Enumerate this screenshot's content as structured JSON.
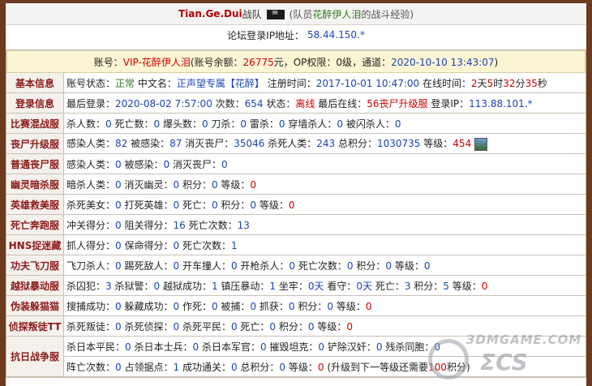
{
  "header": {
    "team": "Tian.Ge.Dui",
    "team_suffix": "战队",
    "member_prefix": "(队员",
    "member_name": "花醉伊人泪",
    "member_suffix": "的战斗经验)",
    "ip_label": "论坛登录IP地址：",
    "ip_value": "58.44.150.*",
    "flag_icon": "pirate-flag-icon"
  },
  "account": {
    "prefix": "账号：",
    "name": "VIP-花醉伊人泪",
    "balance_label": "(账号余额：",
    "balance": "26775",
    "balance_unit": "元，OP权限：",
    "op_level": "0级",
    "channel_label": "，通道：",
    "datetime": "2020-10-10 13:43:07",
    "close": ")"
  },
  "rows": [
    {
      "cat": "基本信息",
      "parts": [
        {
          "t": "账号状态：",
          "c": ""
        },
        {
          "t": "正常",
          "c": "green"
        },
        {
          "t": " 中文名：",
          "c": ""
        },
        {
          "t": "正声望专属【花醉】",
          "c": "blue"
        },
        {
          "t": " 注册时间：",
          "c": ""
        },
        {
          "t": "2017-10-01 10:47:00",
          "c": "blue"
        },
        {
          "t": " 在线时间：",
          "c": ""
        },
        {
          "t": "2",
          "c": "red"
        },
        {
          "t": "天",
          "c": ""
        },
        {
          "t": "5",
          "c": "red"
        },
        {
          "t": "时",
          "c": ""
        },
        {
          "t": "32",
          "c": "red"
        },
        {
          "t": "分",
          "c": ""
        },
        {
          "t": "35",
          "c": "red"
        },
        {
          "t": "秒",
          "c": ""
        }
      ]
    },
    {
      "cat": "登录信息",
      "parts": [
        {
          "t": "最后登录：",
          "c": ""
        },
        {
          "t": "2020-08-02 7:57:00",
          "c": "blue"
        },
        {
          "t": " 次数：",
          "c": ""
        },
        {
          "t": "654",
          "c": "blue"
        },
        {
          "t": " 状态：",
          "c": ""
        },
        {
          "t": "离线",
          "c": "red"
        },
        {
          "t": " 最后在线：",
          "c": ""
        },
        {
          "t": "56丧尸升级服",
          "c": "red"
        },
        {
          "t": " 登录IP：",
          "c": ""
        },
        {
          "t": "113.88.101.*",
          "c": "blue"
        }
      ]
    },
    {
      "cat": "比赛混战服",
      "parts": [
        {
          "t": "杀人数：",
          "c": ""
        },
        {
          "t": "0",
          "c": "blue"
        },
        {
          "t": " 死亡数：",
          "c": ""
        },
        {
          "t": "0",
          "c": "blue"
        },
        {
          "t": " 爆头数：",
          "c": ""
        },
        {
          "t": "0",
          "c": "blue"
        },
        {
          "t": " 刀杀：",
          "c": ""
        },
        {
          "t": "0",
          "c": "blue"
        },
        {
          "t": " 雷杀：",
          "c": ""
        },
        {
          "t": "0",
          "c": "blue"
        },
        {
          "t": " 穿墙杀人：",
          "c": ""
        },
        {
          "t": "0",
          "c": "blue"
        },
        {
          "t": " 被闪杀人：",
          "c": ""
        },
        {
          "t": "0",
          "c": "blue"
        }
      ]
    },
    {
      "cat": "丧尸升级服",
      "avatar": true,
      "parts": [
        {
          "t": "感染人类：",
          "c": ""
        },
        {
          "t": "82",
          "c": "blue"
        },
        {
          "t": " 被感染：",
          "c": ""
        },
        {
          "t": "87",
          "c": "blue"
        },
        {
          "t": " 消灭丧尸：",
          "c": ""
        },
        {
          "t": "35046",
          "c": "blue"
        },
        {
          "t": " 杀死人类：",
          "c": ""
        },
        {
          "t": "243",
          "c": "blue"
        },
        {
          "t": " 总积分：",
          "c": ""
        },
        {
          "t": "1030735",
          "c": "blue"
        },
        {
          "t": " 等级：",
          "c": ""
        },
        {
          "t": "454",
          "c": "red"
        }
      ]
    },
    {
      "cat": "普通丧尸服",
      "parts": [
        {
          "t": "感染人类：",
          "c": ""
        },
        {
          "t": "0",
          "c": "blue"
        },
        {
          "t": " 被感染：",
          "c": ""
        },
        {
          "t": "0",
          "c": "blue"
        },
        {
          "t": " 消灭丧尸：",
          "c": ""
        },
        {
          "t": "0",
          "c": "blue"
        }
      ]
    },
    {
      "cat": "幽灵暗杀服",
      "parts": [
        {
          "t": "暗杀人类：",
          "c": ""
        },
        {
          "t": "0",
          "c": "blue"
        },
        {
          "t": " 消灭幽灵：",
          "c": ""
        },
        {
          "t": "0",
          "c": "blue"
        },
        {
          "t": " 积分：",
          "c": ""
        },
        {
          "t": "0",
          "c": "blue"
        },
        {
          "t": " 等级：",
          "c": ""
        },
        {
          "t": "0",
          "c": "red"
        }
      ]
    },
    {
      "cat": "英雄救美服",
      "parts": [
        {
          "t": "杀死美女：",
          "c": ""
        },
        {
          "t": "0",
          "c": "blue"
        },
        {
          "t": " 打死英雄：",
          "c": ""
        },
        {
          "t": "0",
          "c": "blue"
        },
        {
          "t": " 死亡：",
          "c": ""
        },
        {
          "t": "0",
          "c": "blue"
        },
        {
          "t": " 积分：",
          "c": ""
        },
        {
          "t": "0",
          "c": "blue"
        },
        {
          "t": " 等级：",
          "c": ""
        },
        {
          "t": "0",
          "c": "red"
        }
      ]
    },
    {
      "cat": "死亡奔跑服",
      "parts": [
        {
          "t": "冲关得分：",
          "c": ""
        },
        {
          "t": "0",
          "c": "blue"
        },
        {
          "t": " 阻关得分：",
          "c": ""
        },
        {
          "t": "16",
          "c": "blue"
        },
        {
          "t": " 死亡次数：",
          "c": ""
        },
        {
          "t": "13",
          "c": "blue"
        }
      ]
    },
    {
      "cat": "HNS捉迷藏",
      "parts": [
        {
          "t": "抓人得分：",
          "c": ""
        },
        {
          "t": "0",
          "c": "blue"
        },
        {
          "t": " 保命得分：",
          "c": ""
        },
        {
          "t": "0",
          "c": "blue"
        },
        {
          "t": " 死亡次数：",
          "c": ""
        },
        {
          "t": "1",
          "c": "blue"
        }
      ]
    },
    {
      "cat": "功夫飞刀服",
      "parts": [
        {
          "t": "飞刀杀人：",
          "c": ""
        },
        {
          "t": "0",
          "c": "blue"
        },
        {
          "t": " 踢死敌人：",
          "c": ""
        },
        {
          "t": "0",
          "c": "blue"
        },
        {
          "t": " 开车撞人：",
          "c": ""
        },
        {
          "t": "0",
          "c": "blue"
        },
        {
          "t": " 开枪杀人：",
          "c": ""
        },
        {
          "t": "0",
          "c": "blue"
        },
        {
          "t": " 死亡次数：",
          "c": ""
        },
        {
          "t": "0",
          "c": "blue"
        },
        {
          "t": " 积分：",
          "c": ""
        },
        {
          "t": "0",
          "c": "blue"
        },
        {
          "t": " 等级：",
          "c": ""
        },
        {
          "t": "0",
          "c": "blue"
        }
      ]
    },
    {
      "cat": "越狱暴动服",
      "parts": [
        {
          "t": "杀囚犯：",
          "c": ""
        },
        {
          "t": "3",
          "c": "blue"
        },
        {
          "t": " 杀狱警：",
          "c": ""
        },
        {
          "t": "0",
          "c": "blue"
        },
        {
          "t": " 越狱成功：",
          "c": ""
        },
        {
          "t": "1",
          "c": "blue"
        },
        {
          "t": " 镇压暴动：",
          "c": ""
        },
        {
          "t": "1",
          "c": "blue"
        },
        {
          "t": " 坐牢：",
          "c": ""
        },
        {
          "t": "0天",
          "c": "blue"
        },
        {
          "t": " 看守：",
          "c": ""
        },
        {
          "t": "0天",
          "c": "blue"
        },
        {
          "t": " 死亡：",
          "c": ""
        },
        {
          "t": "3",
          "c": "blue"
        },
        {
          "t": " 积分：",
          "c": ""
        },
        {
          "t": "5",
          "c": "blue"
        },
        {
          "t": " 等级：",
          "c": ""
        },
        {
          "t": "0",
          "c": "red"
        }
      ]
    },
    {
      "cat": "伪装躲猫猫",
      "parts": [
        {
          "t": "搜捕成功：",
          "c": ""
        },
        {
          "t": "0",
          "c": "blue"
        },
        {
          "t": " 躲藏成功：",
          "c": ""
        },
        {
          "t": "0",
          "c": "blue"
        },
        {
          "t": " 作死：",
          "c": ""
        },
        {
          "t": "0",
          "c": "blue"
        },
        {
          "t": " 被捕：",
          "c": ""
        },
        {
          "t": "0",
          "c": "blue"
        },
        {
          "t": " 抓获：",
          "c": ""
        },
        {
          "t": "0",
          "c": "blue"
        },
        {
          "t": " 积分：",
          "c": ""
        },
        {
          "t": "0",
          "c": "blue"
        },
        {
          "t": " 等级：",
          "c": ""
        },
        {
          "t": "0",
          "c": "red"
        }
      ]
    },
    {
      "cat": "侦探叛徒TT",
      "parts": [
        {
          "t": "杀死叛徒：",
          "c": ""
        },
        {
          "t": "0",
          "c": "blue"
        },
        {
          "t": " 杀死侦探：",
          "c": ""
        },
        {
          "t": "0",
          "c": "blue"
        },
        {
          "t": " 杀死平民：",
          "c": ""
        },
        {
          "t": "0",
          "c": "blue"
        },
        {
          "t": " 死亡：",
          "c": ""
        },
        {
          "t": "0",
          "c": "blue"
        },
        {
          "t": " 积分：",
          "c": ""
        },
        {
          "t": "0",
          "c": "blue"
        },
        {
          "t": " 等级：",
          "c": ""
        },
        {
          "t": "0",
          "c": "red"
        }
      ]
    }
  ],
  "war": {
    "cat": "抗日战争服",
    "line1": [
      {
        "t": "杀日本平民：",
        "c": ""
      },
      {
        "t": "0",
        "c": "blue"
      },
      {
        "t": " 杀日本士兵：",
        "c": ""
      },
      {
        "t": "0",
        "c": "blue"
      },
      {
        "t": " 杀日本军官：",
        "c": ""
      },
      {
        "t": "0",
        "c": "blue"
      },
      {
        "t": " 摧毁坦克：",
        "c": ""
      },
      {
        "t": "0",
        "c": "blue"
      },
      {
        "t": " 铲除汉奸：",
        "c": ""
      },
      {
        "t": "0",
        "c": "blue"
      },
      {
        "t": " 残杀同胞：",
        "c": ""
      },
      {
        "t": "0",
        "c": "blue"
      }
    ],
    "line2": [
      {
        "t": "阵亡次数：",
        "c": ""
      },
      {
        "t": "0",
        "c": "blue"
      },
      {
        "t": " 占领据点：",
        "c": ""
      },
      {
        "t": "1",
        "c": "blue"
      },
      {
        "t": " 成功通关：",
        "c": ""
      },
      {
        "t": "0",
        "c": "blue"
      },
      {
        "t": " 总积分：",
        "c": ""
      },
      {
        "t": "0",
        "c": "blue"
      },
      {
        "t": " 等级：",
        "c": ""
      },
      {
        "t": "0",
        "c": "red"
      },
      {
        "t": " (升级到下一等级还需要",
        "c": ""
      },
      {
        "t": "100",
        "c": "red"
      },
      {
        "t": "积分)",
        "c": ""
      }
    ]
  },
  "watermark": {
    "line1": "3DMGAME.COM",
    "line2": "ΣCS"
  }
}
